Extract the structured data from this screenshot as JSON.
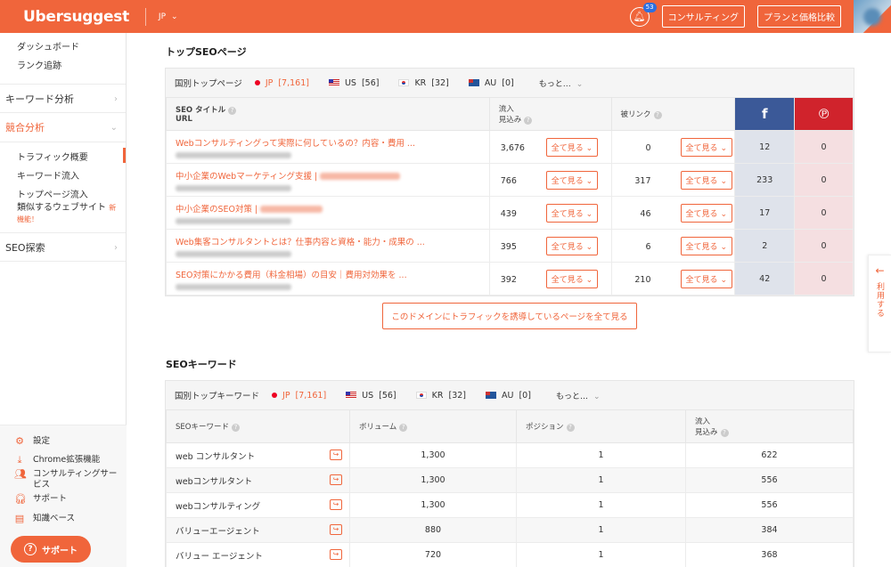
{
  "brand": {
    "logo": "Ubersuggest",
    "country": "JP",
    "accent": "#f0653b"
  },
  "header": {
    "notification_count": "53",
    "consulting_label": "コンサルティング",
    "plans_label": "プランと価格比較"
  },
  "sidebar": {
    "top_items": [
      "ダッシュボード",
      "ランク追跡"
    ],
    "sections": {
      "keyword_analysis": "キーワード分析",
      "competitor_analysis": "競合分析",
      "seo_explore": "SEO探索"
    },
    "competitor_items": [
      "トラフィック概要",
      "キーワード流入",
      "トップページ流入",
      "類似するウェブサイト"
    ],
    "new_tag": "新機能！",
    "bottom_items": [
      "設定",
      "Chrome拡張機能",
      "コンサルティングサービス",
      "サポート",
      "知識ベース"
    ],
    "support_button": "サポート"
  },
  "top_pages": {
    "title": "トップSEOページ",
    "country_label": "国別トップページ",
    "countries": [
      {
        "code": "JP",
        "count": "[7,161]"
      },
      {
        "code": "US",
        "count": "[56]"
      },
      {
        "code": "KR",
        "count": "[32]"
      },
      {
        "code": "AU",
        "count": "[0]"
      }
    ],
    "more_label": "もっと…",
    "columns": {
      "seo_title": "SEO タイトル",
      "url": "URL",
      "traffic": "流入",
      "traffic_sub": "見込み",
      "backlinks": "被リンク"
    },
    "see_all_label": "全て見る",
    "rows": [
      {
        "title": "Webコンサルティングって実際に何しているの？内容・費用 ...",
        "traffic": "3,676",
        "backlinks": "0",
        "fb": "12",
        "pin": "0"
      },
      {
        "title": "中小企業のWebマーケティング支援 |",
        "traffic": "766",
        "backlinks": "317",
        "fb": "233",
        "pin": "0"
      },
      {
        "title": "中小企業のSEO対策 |",
        "traffic": "439",
        "backlinks": "46",
        "fb": "17",
        "pin": "0"
      },
      {
        "title": "Web集客コンサルタントとは？仕事内容と資格・能力・成果の ...",
        "traffic": "395",
        "backlinks": "6",
        "fb": "2",
        "pin": "0"
      },
      {
        "title": "SEO対策にかかる費用（料金相場）の目安｜費用対効果を ...",
        "traffic": "392",
        "backlinks": "210",
        "fb": "42",
        "pin": "0"
      }
    ],
    "cta_label": "このドメインにトラフィックを誘導しているページを全て見る"
  },
  "keywords": {
    "title": "SEOキーワード",
    "country_label": "国別トップキーワード",
    "countries": [
      {
        "code": "JP",
        "count": "[7,161]"
      },
      {
        "code": "US",
        "count": "[56]"
      },
      {
        "code": "KR",
        "count": "[32]"
      },
      {
        "code": "AU",
        "count": "[0]"
      }
    ],
    "more_label": "もっと…",
    "columns": {
      "keyword": "SEOキーワード",
      "volume": "ボリューム",
      "position": "ポジション",
      "traffic": "流入",
      "traffic_sub": "見込み"
    },
    "rows": [
      {
        "keyword": "web コンサルタント",
        "volume": "1,300",
        "position": "1",
        "traffic": "622"
      },
      {
        "keyword": "webコンサルタント",
        "volume": "1,300",
        "position": "1",
        "traffic": "556"
      },
      {
        "keyword": "webコンサルティング",
        "volume": "1,300",
        "position": "1",
        "traffic": "556"
      },
      {
        "keyword": "バリューエージェント",
        "volume": "880",
        "position": "1",
        "traffic": "384"
      },
      {
        "keyword": "バリュー エージェント",
        "volume": "720",
        "position": "1",
        "traffic": "368"
      }
    ]
  },
  "side_tab": {
    "label": "利用する"
  }
}
